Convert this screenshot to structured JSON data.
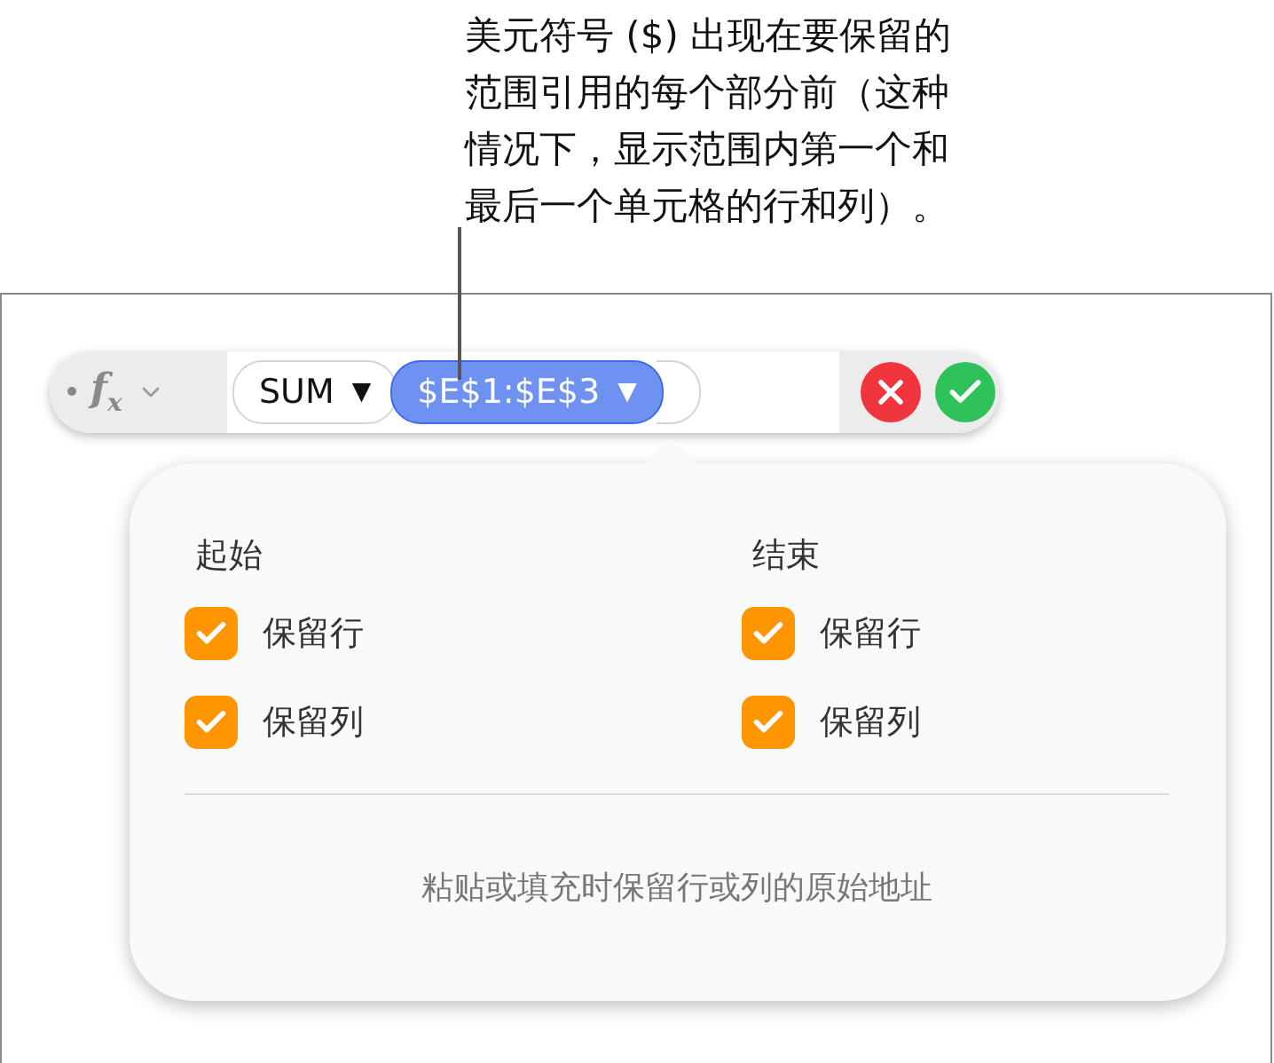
{
  "callout": {
    "text": "美元符号 ($) 出现在要保留的范围引用的每个部分前（这种情况下，显示范围内第一个和最后一个单元格的行和列）。"
  },
  "formula_bar": {
    "function_symbol": "f$_{x}$",
    "function_token": {
      "label": "SUM",
      "caret": "▼"
    },
    "reference_token": {
      "label": "$E$1:$E$3",
      "caret": "▼",
      "selected": true
    }
  },
  "popover": {
    "columns": [
      {
        "heading": "起始",
        "options": [
          {
            "label": "保留行",
            "checked": true
          },
          {
            "label": "保留列",
            "checked": true
          }
        ]
      },
      {
        "heading": "结束",
        "options": [
          {
            "label": "保留行",
            "checked": true
          },
          {
            "label": "保留列",
            "checked": true
          }
        ]
      }
    ],
    "footer": "粘贴或填充时保留行或列的原始地址"
  }
}
